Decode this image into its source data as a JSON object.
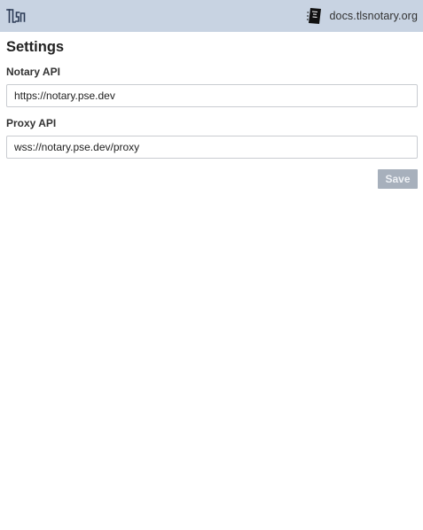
{
  "header": {
    "logo_icon": "tlsn-logo-icon",
    "site_icon": "notebook-icon",
    "site_label": "docs.tlsnotary.org",
    "background_color": "#c8d3e2"
  },
  "settings": {
    "title": "Settings",
    "notary": {
      "label": "Notary API",
      "value": "https://notary.pse.dev"
    },
    "proxy": {
      "label": "Proxy API",
      "value": "wss://notary.pse.dev/proxy"
    },
    "save_label": "Save",
    "save_color": "#a7b0bc"
  }
}
